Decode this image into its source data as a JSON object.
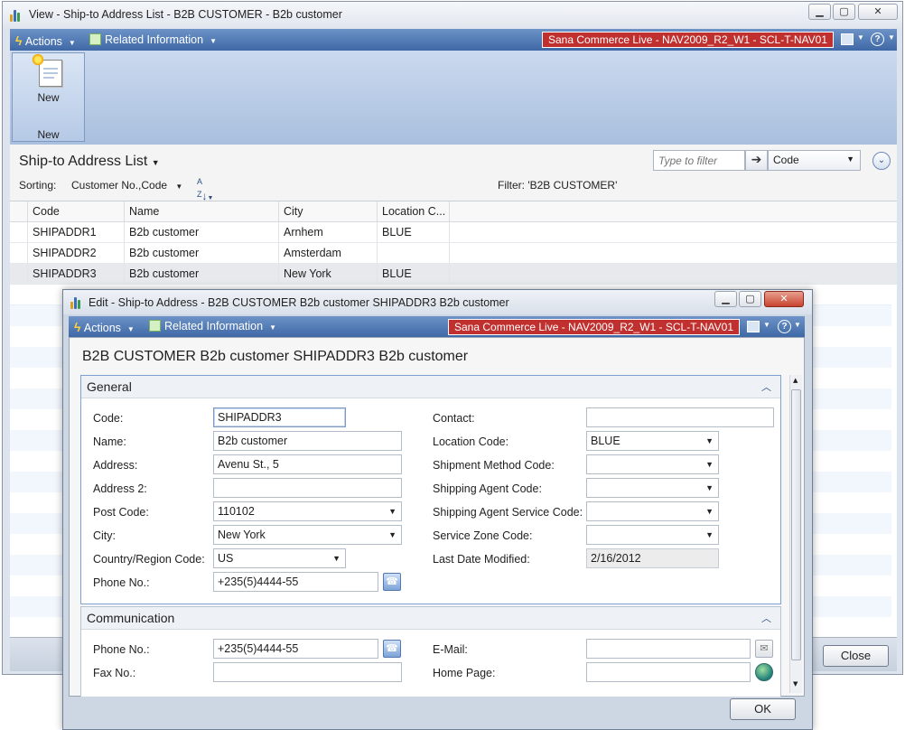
{
  "back_window": {
    "title": "View - Ship-to Address List - B2B CUSTOMER - B2b customer",
    "command_bar": {
      "actions_label": "Actions",
      "related_label": "Related Information",
      "server_badge": "Sana Commerce Live - NAV2009_R2_W1 - SCL-T-NAV01"
    },
    "ribbon": {
      "new_button_label": "New",
      "group_label": "New"
    },
    "list": {
      "title": "Ship-to Address List",
      "filter_placeholder": "Type to filter",
      "filter_field": "Code",
      "sorting_label": "Sorting:",
      "sorting_value": "Customer No.,Code",
      "filter_text": "Filter: 'B2B CUSTOMER'",
      "columns": [
        "Code",
        "Name",
        "City",
        "Location C..."
      ],
      "rows": [
        {
          "code": "SHIPADDR1",
          "name": "B2b customer",
          "city": "Arnhem",
          "location": "BLUE"
        },
        {
          "code": "SHIPADDR2",
          "name": "B2b customer",
          "city": "Amsterdam",
          "location": ""
        },
        {
          "code": "SHIPADDR3",
          "name": "B2b customer",
          "city": "New York",
          "location": "BLUE"
        }
      ]
    },
    "close_button": "Close"
  },
  "dialog": {
    "title": "Edit - Ship-to Address - B2B CUSTOMER B2b customer SHIPADDR3 B2b customer",
    "command_bar": {
      "actions_label": "Actions",
      "related_label": "Related Information",
      "server_badge": "Sana Commerce Live - NAV2009_R2_W1 - SCL-T-NAV01"
    },
    "card_title": "B2B CUSTOMER B2b customer SHIPADDR3 B2b customer",
    "general": {
      "title": "General",
      "code_label": "Code:",
      "code": "SHIPADDR3",
      "name_label": "Name:",
      "name": "B2b customer",
      "address_label": "Address:",
      "address": "Avenu St., 5",
      "address2_label": "Address 2:",
      "address2": "",
      "postcode_label": "Post Code:",
      "postcode": "110102",
      "city_label": "City:",
      "city": "New York",
      "country_label": "Country/Region Code:",
      "country": "US",
      "phone_label": "Phone No.:",
      "phone": "+235(5)4444-55",
      "contact_label": "Contact:",
      "contact": "",
      "location_label": "Location Code:",
      "location": "BLUE",
      "shipment_label": "Shipment Method Code:",
      "shipment": "",
      "agent_label": "Shipping Agent Code:",
      "agent": "",
      "agent_service_label": "Shipping Agent Service Code:",
      "agent_service": "",
      "zone_label": "Service Zone Code:",
      "zone": "",
      "modified_label": "Last Date Modified:",
      "modified": "2/16/2012"
    },
    "communication": {
      "title": "Communication",
      "phone_label": "Phone No.:",
      "phone": "+235(5)4444-55",
      "fax_label": "Fax No.:",
      "fax": "",
      "email_label": "E-Mail:",
      "email": "",
      "homepage_label": "Home Page:",
      "homepage": ""
    },
    "ok_button": "OK"
  },
  "icons": {
    "actions": "lightning-icon",
    "related": "related-info-icon",
    "view": "view-icon",
    "help": "help-icon"
  },
  "colors": {
    "command_bar": "#4a74b0",
    "server_badge": "#c0302e",
    "selected_row": "#e7e9ec"
  }
}
